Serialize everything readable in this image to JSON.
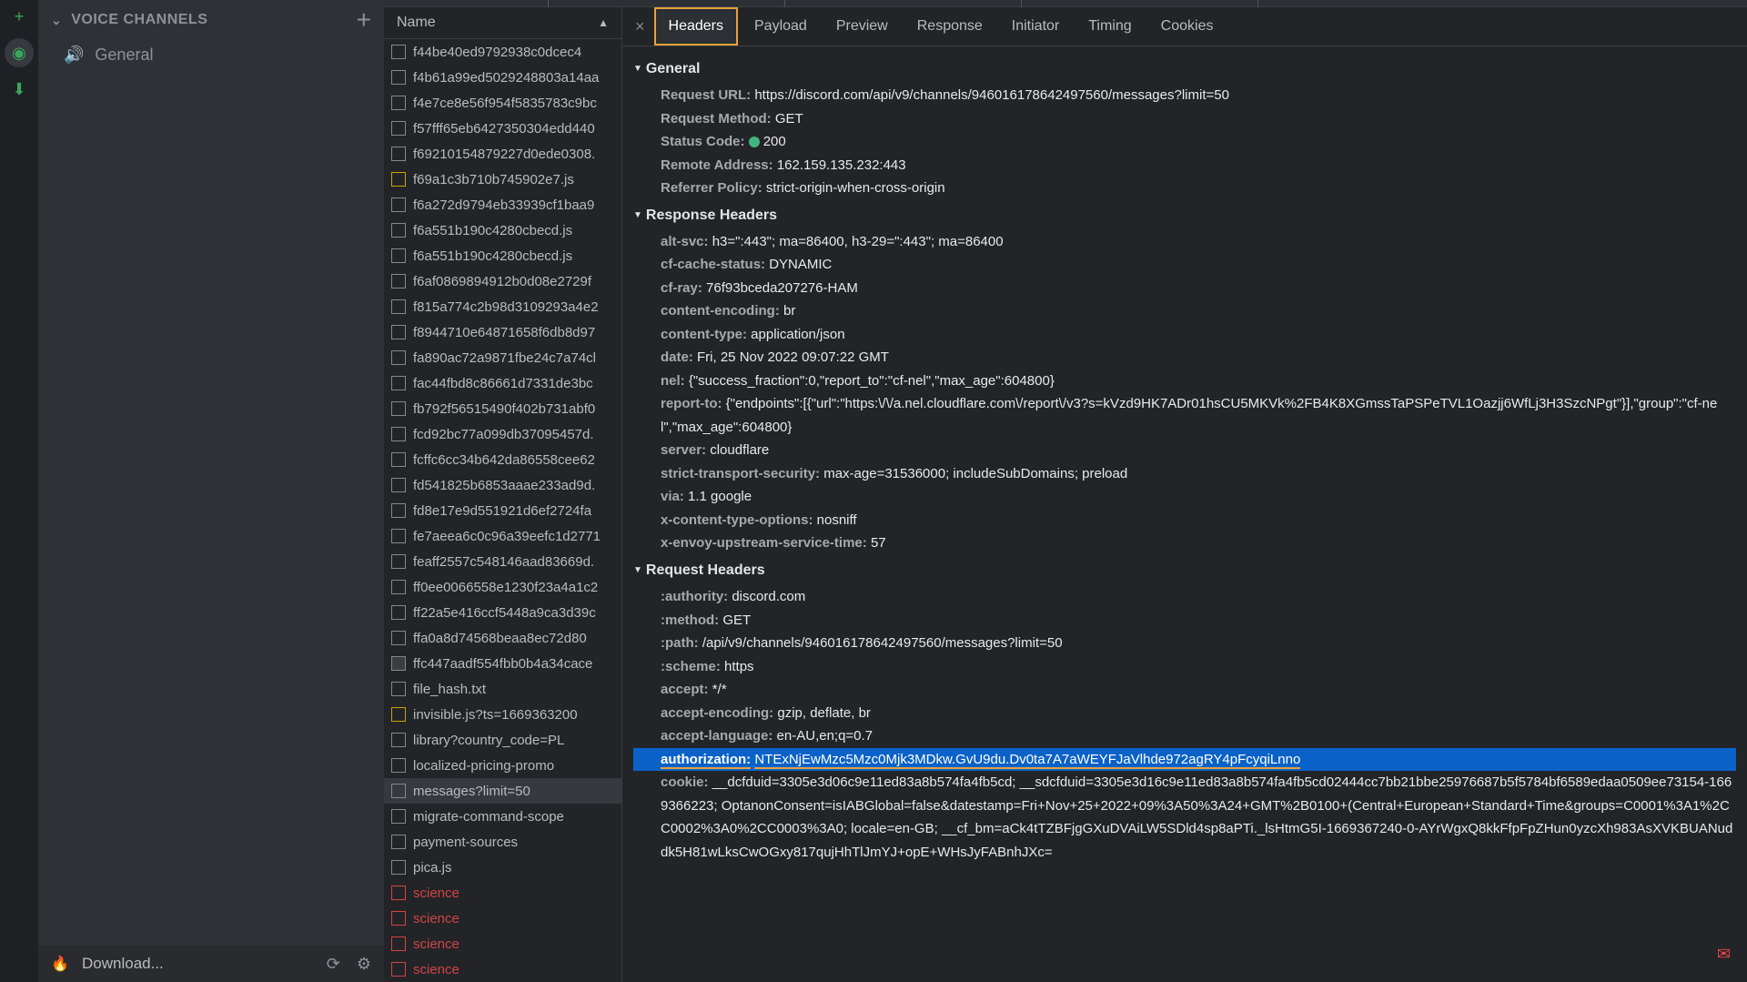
{
  "sidebar": {
    "voice_header": "VOICE CHANNELS",
    "general": "General"
  },
  "net": {
    "column_name": "Name",
    "requests": [
      {
        "name": "f44be40ed9792938c0dcec4",
        "type": "doc"
      },
      {
        "name": "f4b61a99ed5029248803a14aa",
        "type": "doc"
      },
      {
        "name": "f4e7ce8e56f954f5835783c9bc",
        "type": "doc"
      },
      {
        "name": "f57fff65eb6427350304edd440",
        "type": "doc"
      },
      {
        "name": "f69210154879227d0ede0308.",
        "type": "doc"
      },
      {
        "name": "f69a1c3b710b745902e7.js",
        "type": "js"
      },
      {
        "name": "f6a272d9794eb33939cf1baa9",
        "type": "doc"
      },
      {
        "name": "f6a551b190c4280cbecd.js",
        "type": "doc"
      },
      {
        "name": "f6a551b190c4280cbecd.js",
        "type": "doc"
      },
      {
        "name": "f6af0869894912b0d08e2729f",
        "type": "doc"
      },
      {
        "name": "f815a774c2b98d3109293a4e2",
        "type": "doc"
      },
      {
        "name": "f8944710e64871658f6db8d97",
        "type": "doc"
      },
      {
        "name": "fa890ac72a9871fbe24c7a74cl",
        "type": "doc"
      },
      {
        "name": "fac44fbd8c86661d7331de3bc",
        "type": "doc"
      },
      {
        "name": "fb792f56515490f402b731abf0",
        "type": "doc"
      },
      {
        "name": "fcd92bc77a099db37095457d.",
        "type": "doc"
      },
      {
        "name": "fcffc6cc34b642da86558cee62",
        "type": "doc"
      },
      {
        "name": "fd541825b6853aaae233ad9d.",
        "type": "doc"
      },
      {
        "name": "fd8e17e9d551921d6ef2724fa",
        "type": "doc"
      },
      {
        "name": "fe7aeea6c0c96a39eefc1d2771",
        "type": "doc"
      },
      {
        "name": "feaff2557c548146aad83669d.",
        "type": "doc"
      },
      {
        "name": "ff0ee0066558e1230f23a4a1c2",
        "type": "doc"
      },
      {
        "name": "ff22a5e416ccf5448a9ca3d39c",
        "type": "doc"
      },
      {
        "name": "ffa0a8d74568beaa8ec72d80",
        "type": "doc"
      },
      {
        "name": "ffc447aadf554fbb0b4a34cace",
        "type": "sel"
      },
      {
        "name": "file_hash.txt",
        "type": "doc"
      },
      {
        "name": "invisible.js?ts=1669363200",
        "type": "js"
      },
      {
        "name": "library?country_code=PL",
        "type": "doc"
      },
      {
        "name": "localized-pricing-promo",
        "type": "doc"
      },
      {
        "name": "messages?limit=50",
        "type": "doc",
        "selected": true
      },
      {
        "name": "migrate-command-scope",
        "type": "doc"
      },
      {
        "name": "payment-sources",
        "type": "doc"
      },
      {
        "name": "pica.js",
        "type": "doc"
      },
      {
        "name": "science",
        "type": "red"
      },
      {
        "name": "science",
        "type": "red"
      },
      {
        "name": "science",
        "type": "red"
      },
      {
        "name": "science",
        "type": "red"
      }
    ]
  },
  "tabs": {
    "headers": "Headers",
    "payload": "Payload",
    "preview": "Preview",
    "response": "Response",
    "initiator": "Initiator",
    "timing": "Timing",
    "cookies": "Cookies"
  },
  "sections": {
    "general": "General",
    "response_headers": "Response Headers",
    "request_headers": "Request Headers"
  },
  "general": {
    "request_url_k": "Request URL:",
    "request_url_v": "https://discord.com/api/v9/channels/946016178642497560/messages?limit=50",
    "request_method_k": "Request Method:",
    "request_method_v": "GET",
    "status_code_k": "Status Code:",
    "status_code_v": "200",
    "remote_address_k": "Remote Address:",
    "remote_address_v": "162.159.135.232:443",
    "referrer_policy_k": "Referrer Policy:",
    "referrer_policy_v": "strict-origin-when-cross-origin"
  },
  "resp": [
    {
      "k": "alt-svc:",
      "v": "h3=\":443\"; ma=86400, h3-29=\":443\"; ma=86400"
    },
    {
      "k": "cf-cache-status:",
      "v": "DYNAMIC"
    },
    {
      "k": "cf-ray:",
      "v": "76f93bceda207276-HAM"
    },
    {
      "k": "content-encoding:",
      "v": "br"
    },
    {
      "k": "content-type:",
      "v": "application/json"
    },
    {
      "k": "date:",
      "v": "Fri, 25 Nov 2022 09:07:22 GMT"
    },
    {
      "k": "nel:",
      "v": "{\"success_fraction\":0,\"report_to\":\"cf-nel\",\"max_age\":604800}"
    },
    {
      "k": "report-to:",
      "v": "{\"endpoints\":[{\"url\":\"https:\\/\\/a.nel.cloudflare.com\\/report\\/v3?s=kVzd9HK7ADr01hsCU5MKVk%2FB4K8XGmssTaPSPeTVL1Oazjj6WfLj3H3SzcNPgt\"}],\"group\":\"cf-nel\",\"max_age\":604800}"
    },
    {
      "k": "server:",
      "v": "cloudflare"
    },
    {
      "k": "strict-transport-security:",
      "v": "max-age=31536000; includeSubDomains; preload"
    },
    {
      "k": "via:",
      "v": "1.1 google"
    },
    {
      "k": "x-content-type-options:",
      "v": "nosniff"
    },
    {
      "k": "x-envoy-upstream-service-time:",
      "v": "57"
    }
  ],
  "req": [
    {
      "k": ":authority:",
      "v": "discord.com"
    },
    {
      "k": ":method:",
      "v": "GET"
    },
    {
      "k": ":path:",
      "v": "/api/v9/channels/946016178642497560/messages?limit=50"
    },
    {
      "k": ":scheme:",
      "v": "https"
    },
    {
      "k": "accept:",
      "v": "*/*"
    },
    {
      "k": "accept-encoding:",
      "v": "gzip, deflate, br"
    },
    {
      "k": "accept-language:",
      "v": "en-AU,en;q=0.7"
    },
    {
      "k": "authorization:",
      "v": "NTExNjEwMzc5Mzc0Mjk3MDkw.GvU9du.Dv0ta7A7aWEYFJaVlhde972agRY4pFcyqiLnno",
      "hl": true
    },
    {
      "k": "cookie:",
      "v": "__dcfduid=3305e3d06c9e11ed83a8b574fa4fb5cd; __sdcfduid=3305e3d16c9e11ed83a8b574fa4fb5cd02444cc7bb21bbe25976687b5f5784bf6589edaa0509ee73154-1669366223; OptanonConsent=isIABGlobal=false&datestamp=Fri+Nov+25+2022+09%3A50%3A24+GMT%2B0100+(Central+European+Standard+Time&groups=C0001%3A1%2CC0002%3A0%2CC0003%3A0; locale=en-GB; __cf_bm=aCk4tTZBFjgGXuDVAiLW5SDld4sp8aPTi._lsHtmG5I-1669367240-0-AYrWgxQ8kkFfpFpZHun0yzcXh983AsXVKBUANuddk5H81wLksCwOGxy817qujHhTlJmYJ+opE+WHsJyFABnhJXc="
    }
  ],
  "footer": {
    "download": "Download..."
  }
}
